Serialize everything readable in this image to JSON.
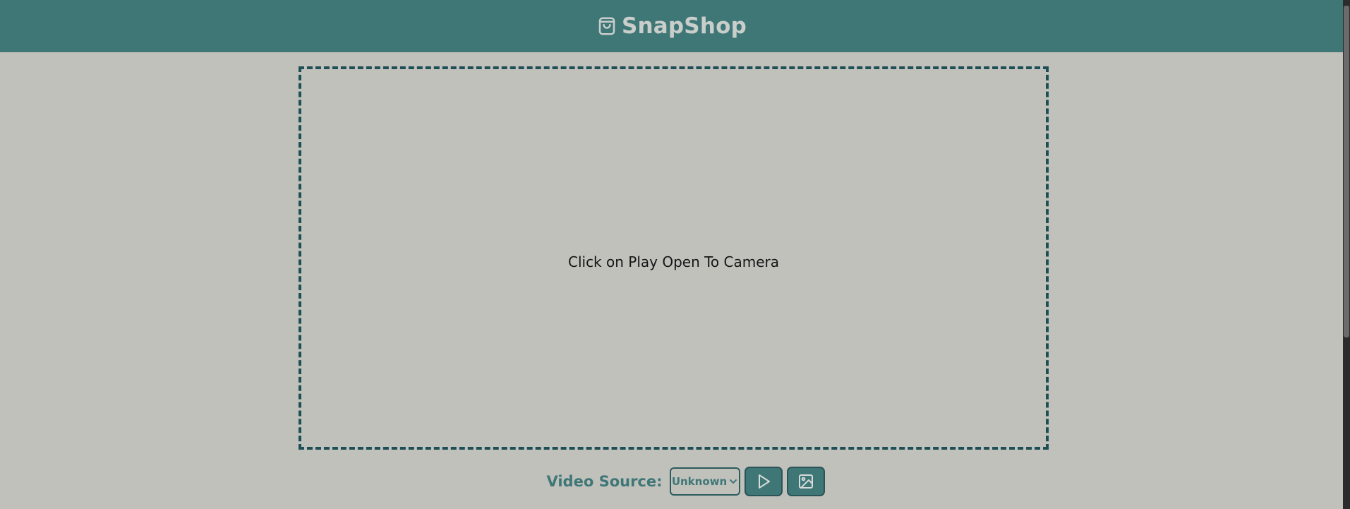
{
  "header": {
    "title": "SnapShop",
    "icon": "shopping-bag-icon"
  },
  "preview": {
    "message": "Click on Play Open To Camera"
  },
  "controls": {
    "video_source_label": "Video Source:",
    "video_source_selected": "Unknown",
    "play_icon": "play-icon",
    "image_icon": "image-icon"
  },
  "colors": {
    "header_bg": "#3f7777",
    "page_bg": "#c1c1bc",
    "accent": "#3f7777",
    "border": "#1e4f55"
  }
}
